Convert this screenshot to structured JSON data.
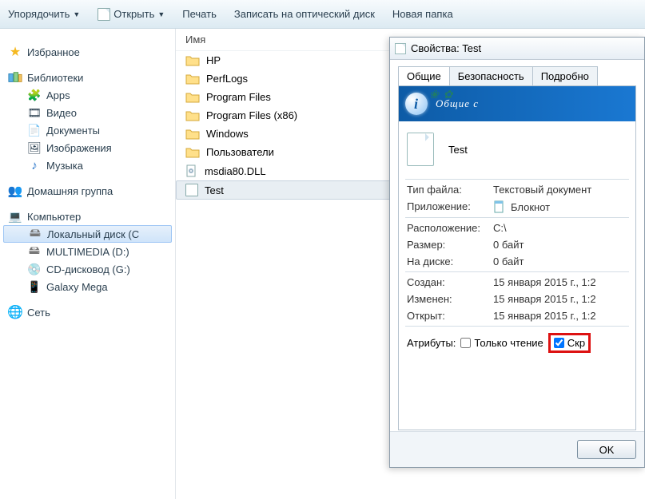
{
  "toolbar": {
    "organize": "Упорядочить",
    "open": "Открыть",
    "print": "Печать",
    "burn": "Записать на оптический диск",
    "new_folder": "Новая папка"
  },
  "sidebar": {
    "favorites": "Избранное",
    "libraries": "Библиотеки",
    "libs": [
      "Apps",
      "Видео",
      "Документы",
      "Изображения",
      "Музыка"
    ],
    "homegroup": "Домашняя группа",
    "computer": "Компьютер",
    "drives": [
      "Локальный диск (C",
      "MULTIMEDIA (D:)",
      "CD-дисковод (G:)",
      "Galaxy Mega"
    ],
    "network": "Сеть"
  },
  "filelist": {
    "column_name": "Имя",
    "items": [
      {
        "name": "HP",
        "type": "folder"
      },
      {
        "name": "PerfLogs",
        "type": "folder"
      },
      {
        "name": "Program Files",
        "type": "folder"
      },
      {
        "name": "Program Files (x86)",
        "type": "folder"
      },
      {
        "name": "Windows",
        "type": "folder"
      },
      {
        "name": "Пользователи",
        "type": "folder"
      },
      {
        "name": "msdia80.DLL",
        "type": "dll"
      },
      {
        "name": "Test",
        "type": "txt",
        "selected": true
      }
    ]
  },
  "dialog": {
    "title": "Свойства: Test",
    "tabs": [
      "Общие",
      "Безопасность",
      "Подробно"
    ],
    "banner": "Общие с",
    "file_name": "Test",
    "rows": {
      "type_label": "Тип файла:",
      "type_value": "Текстовый документ",
      "app_label": "Приложение:",
      "app_value": "Блокнот",
      "loc_label": "Расположение:",
      "loc_value": "C:\\",
      "size_label": "Размер:",
      "size_value": "0 байт",
      "disk_label": "На диске:",
      "disk_value": "0 байт",
      "created_label": "Создан:",
      "created_value": "15 января 2015 г., 1:2",
      "modified_label": "Изменен:",
      "modified_value": "15 января 2015 г., 1:2",
      "opened_label": "Открыт:",
      "opened_value": "15 января 2015 г., 1:2",
      "attr_label": "Атрибуты:",
      "readonly": "Только чтение",
      "hidden": "Скр"
    },
    "ok": "OK"
  }
}
